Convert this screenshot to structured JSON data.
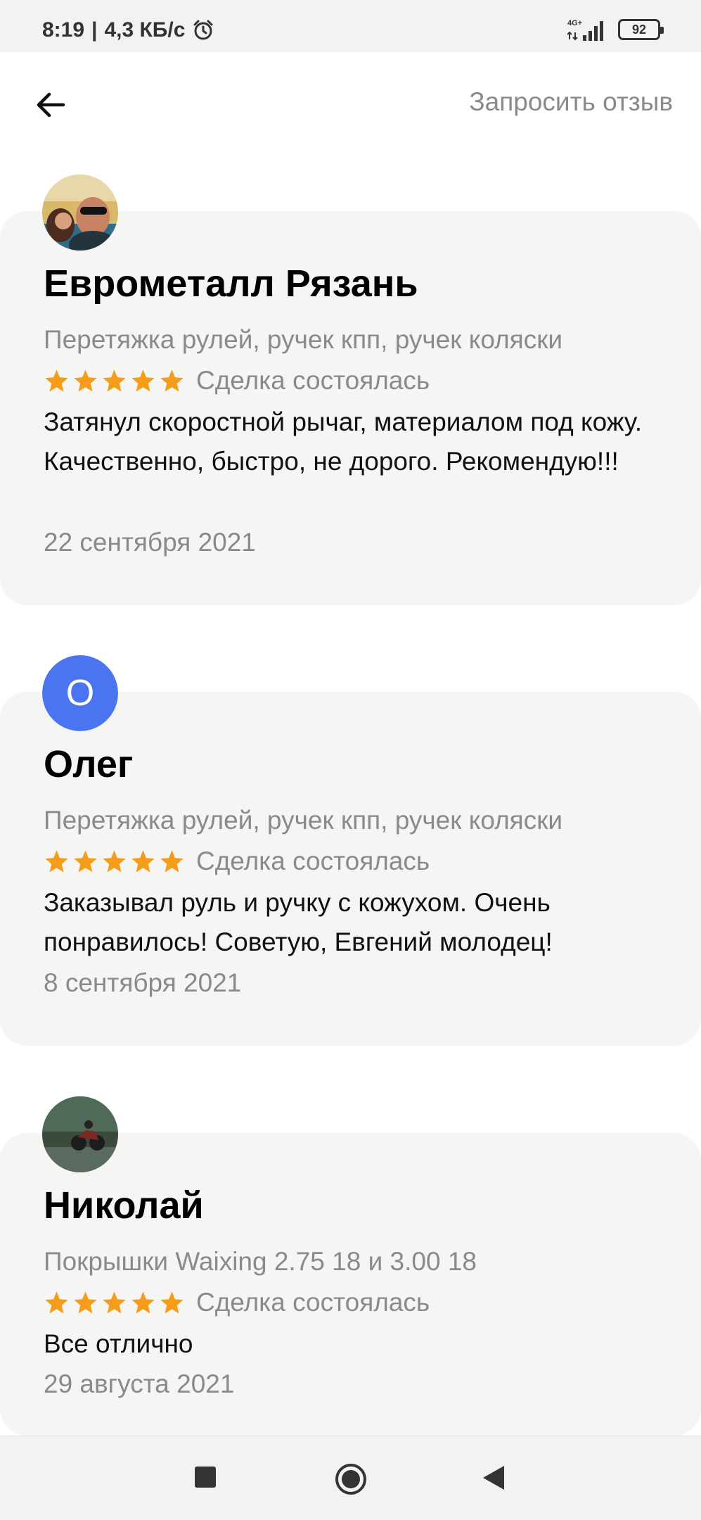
{
  "status_bar": {
    "time": "8:19",
    "speed": "4,3 КБ/с",
    "network": "4G+",
    "battery": "92",
    "icons": [
      "alarm-icon",
      "signal-icon",
      "battery-icon"
    ]
  },
  "header": {
    "back_icon": "arrow-left-icon",
    "request_review": "Запросить отзыв"
  },
  "colors": {
    "card_bg": "#f5f5f4",
    "star": "#f59c1a",
    "avatar_letter_bg": "#4a74f0",
    "secondary_text": "#8a8a8a"
  },
  "reviews": [
    {
      "name": "Еврометалл Рязань",
      "avatar": "photo-avatar",
      "service": "Перетяжка рулей, ручек кпп, ручек коляски",
      "rating": 5,
      "status": "Сделка состоялась",
      "text": "Затянул скоростной рычаг, материалом под кожу. Качественно, быстро, не дорого. Рекомендую!!!",
      "date": "22 сентября 2021"
    },
    {
      "name": "Олег",
      "avatar_letter": "О",
      "service": "Перетяжка рулей, ручек кпп, ручек коляски",
      "rating": 5,
      "status": "Сделка состоялась",
      "text": "Заказывал руль и ручку с кожухом. Очень понравилось! Советую, Евгений молодец!",
      "date": "8 сентября 2021"
    },
    {
      "name": "Николай",
      "avatar": "photo-avatar",
      "service": "Покрышки Waixing 2.75 18 и 3.00 18",
      "rating": 5,
      "status": "Сделка состоялась",
      "text": "Все отлично",
      "date": "29 августа 2021"
    }
  ],
  "nav_bar": {
    "icons": [
      "recent-apps-icon",
      "home-icon",
      "back-icon"
    ]
  }
}
